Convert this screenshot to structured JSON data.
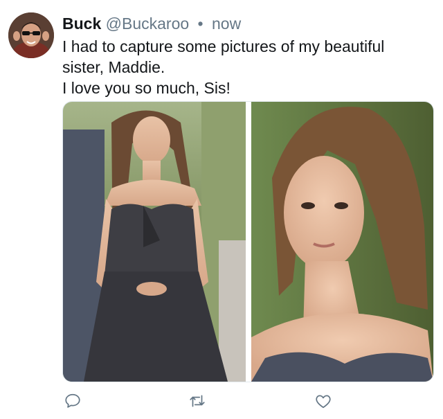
{
  "author": {
    "name": "Buck",
    "handle": "@Buckaroo",
    "separator": "•",
    "time": "now"
  },
  "tweet": {
    "lines": [
      "I had to capture some pictures of my beautiful sister, Maddie.",
      "I love you so much, Sis!"
    ]
  },
  "media": {
    "count": 2
  },
  "actions": {
    "reply_icon": "reply-icon",
    "retweet_icon": "retweet-icon",
    "like_icon": "like-icon"
  },
  "colors": {
    "text_primary": "#14171a",
    "text_secondary": "#657786",
    "icon": "#657786",
    "border": "#e1e8ed"
  }
}
